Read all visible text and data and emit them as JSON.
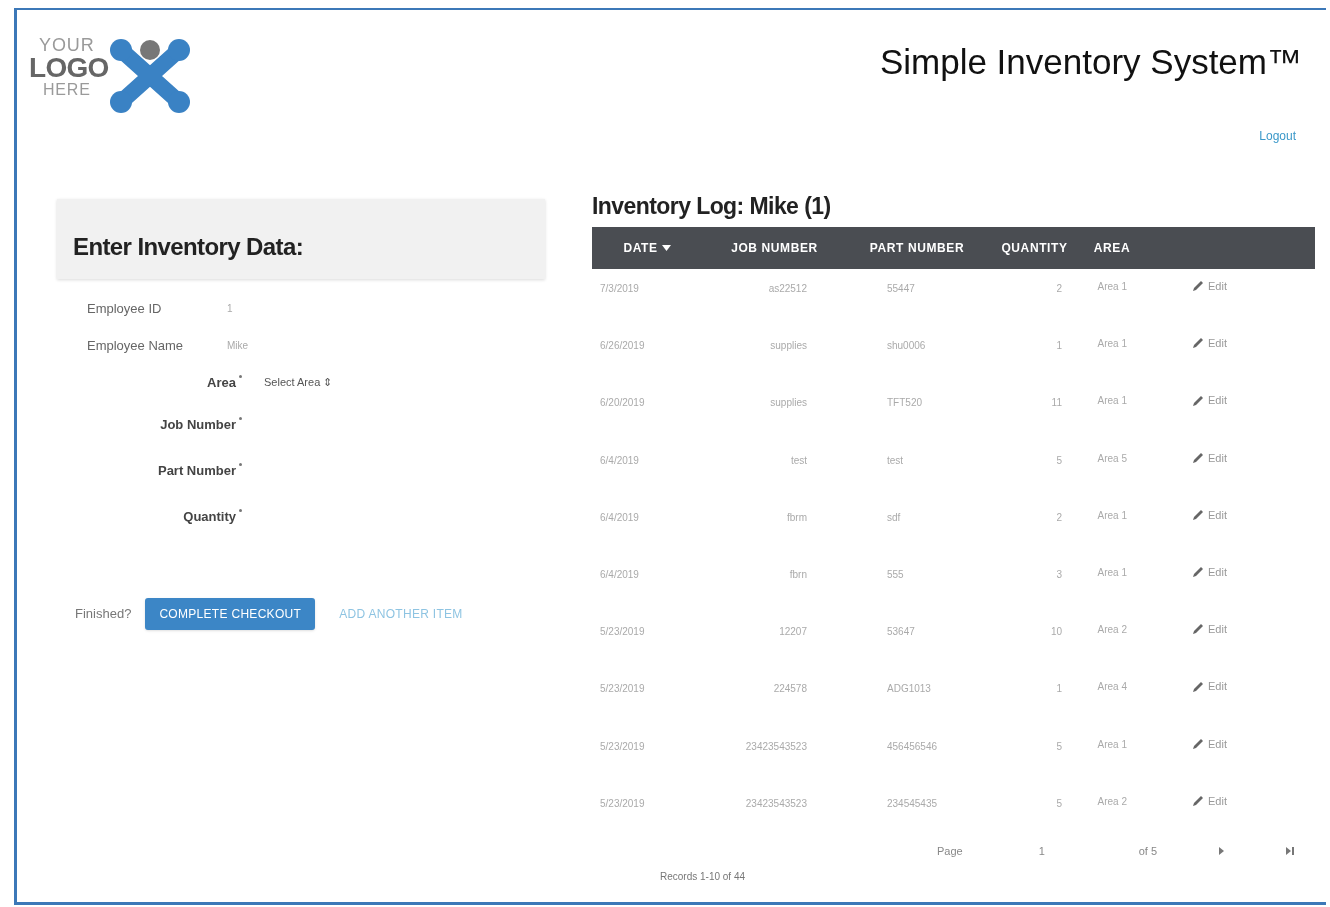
{
  "logo": {
    "lines": [
      "YOUR",
      "LOGO",
      "HERE"
    ]
  },
  "header": {
    "title": "Simple Inventory System™",
    "logout": "Logout"
  },
  "form": {
    "title": "Enter Inventory Data:",
    "info": [
      {
        "label": "Employee ID",
        "value": "1"
      },
      {
        "label": "Employee Name",
        "value": "Mike"
      }
    ],
    "fields": [
      {
        "label": "Area",
        "required": true,
        "kind": "select",
        "placeholder": "Select Area",
        "arrow": "⇕"
      },
      {
        "label": "Job Number",
        "required": true,
        "kind": "text"
      },
      {
        "label": "Part Number",
        "required": true,
        "kind": "text"
      },
      {
        "label": "Quantity",
        "required": true,
        "kind": "text"
      }
    ],
    "finished": "Finished?",
    "primary": "COMPLETE CHECKOUT",
    "secondary": "ADD ANOTHER ITEM"
  },
  "log": {
    "title": "Inventory Log: Mike (1)",
    "columns": [
      {
        "label": "DATE",
        "sorted": true
      },
      {
        "label": "JOB NUMBER",
        "sorted": false
      },
      {
        "label": "PART NUMBER",
        "sorted": false
      },
      {
        "label": "QUANTITY",
        "sorted": false
      },
      {
        "label": "AREA",
        "sorted": false
      }
    ],
    "rows": [
      {
        "cells": [
          "7/3/2019",
          "as22512",
          "55447",
          "2",
          "Area 1"
        ],
        "action": "Edit"
      },
      {
        "cells": [
          "6/26/2019",
          "supplies",
          "shu0006",
          "1",
          "Area 1"
        ],
        "action": "Edit"
      },
      {
        "cells": [
          "6/20/2019",
          "supplies",
          "TFT520",
          "11",
          "Area 1"
        ],
        "action": "Edit"
      },
      {
        "cells": [
          "6/4/2019",
          "test",
          "test",
          "5",
          "Area 5"
        ],
        "action": "Edit"
      },
      {
        "cells": [
          "6/4/2019",
          "fbrm",
          "sdf",
          "2",
          "Area 1"
        ],
        "action": "Edit"
      },
      {
        "cells": [
          "6/4/2019",
          "fbrn",
          "555",
          "3",
          "Area 1"
        ],
        "action": "Edit"
      },
      {
        "cells": [
          "5/23/2019",
          "12207",
          "53647",
          "10",
          "Area 2"
        ],
        "action": "Edit"
      },
      {
        "cells": [
          "5/23/2019",
          "224578",
          "ADG1013",
          "1",
          "Area 4"
        ],
        "action": "Edit"
      },
      {
        "cells": [
          "5/23/2019",
          "23423543523",
          "456456546",
          "5",
          "Area 1"
        ],
        "action": "Edit"
      },
      {
        "cells": [
          "5/23/2019",
          "23423543523",
          "234545435",
          "5",
          "Area 2"
        ],
        "action": "Edit"
      }
    ],
    "pager": {
      "page_label": "Page",
      "page": "1",
      "of": "of 5"
    },
    "records": "Records 1-10 of 44"
  }
}
